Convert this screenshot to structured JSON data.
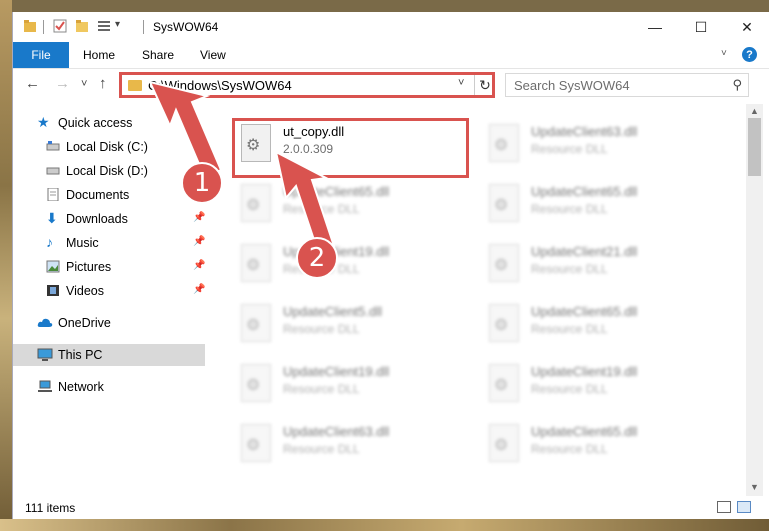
{
  "window": {
    "title": "SysWOW64",
    "controls": {
      "minimize": "—",
      "maximize": "☐",
      "close": "✕"
    }
  },
  "ribbon": {
    "tabs": [
      "File",
      "Home",
      "Share",
      "View"
    ],
    "help": "?"
  },
  "navigation": {
    "back": "←",
    "forward": "→",
    "recent": "˅",
    "up": "↑",
    "address": "C:\\Windows\\SysWOW64",
    "refresh": "↻",
    "search_placeholder": "Search SysWOW64"
  },
  "sidebar": {
    "items": [
      {
        "label": "Quick access",
        "icon": "star-icon"
      },
      {
        "label": "Local Disk (C:)",
        "icon": "drive-icon",
        "pinned": true
      },
      {
        "label": "Local Disk (D:)",
        "icon": "drive-icon"
      },
      {
        "label": "Documents",
        "icon": "documents-icon"
      },
      {
        "label": "Downloads",
        "icon": "download-icon",
        "pinned": true
      },
      {
        "label": "Music",
        "icon": "music-icon",
        "pinned": true
      },
      {
        "label": "Pictures",
        "icon": "pictures-icon",
        "pinned": true
      },
      {
        "label": "Videos",
        "icon": "videos-icon",
        "pinned": true
      },
      {
        "label": "OneDrive",
        "icon": "cloud-icon"
      },
      {
        "label": "This PC",
        "icon": "computer-icon",
        "selected": true
      },
      {
        "label": "Network",
        "icon": "network-icon"
      }
    ]
  },
  "files": [
    {
      "name": "ut_copy.dll",
      "type": "2.0.0.309",
      "highlighted": true
    },
    {
      "name": "UpdateClient63.dll",
      "type": "Resource DLL"
    },
    {
      "name": "UpdateClient65.dll",
      "type": "Resource DLL"
    },
    {
      "name": "UpdateClient65.dll",
      "type": "Resource DLL"
    },
    {
      "name": "UpdateClient19.dll",
      "type": "Resource DLL"
    },
    {
      "name": "UpdateClient21.dll",
      "type": "Resource DLL"
    },
    {
      "name": "UpdateClient5.dll",
      "type": "Resource DLL"
    },
    {
      "name": "UpdateClient65.dll",
      "type": "Resource DLL"
    },
    {
      "name": "UpdateClient19.dll",
      "type": "Resource DLL"
    },
    {
      "name": "UpdateClient19.dll",
      "type": "Resource DLL"
    },
    {
      "name": "UpdateClient63.dll",
      "type": "Resource DLL"
    },
    {
      "name": "UpdateClient65.dll",
      "type": "Resource DLL"
    }
  ],
  "status": {
    "item_count": "111 items"
  },
  "callouts": {
    "one": "1",
    "two": "2"
  },
  "colors": {
    "accent": "#1979ca",
    "callout": "#d9534f",
    "selected_bg": "#d9d9d9"
  }
}
